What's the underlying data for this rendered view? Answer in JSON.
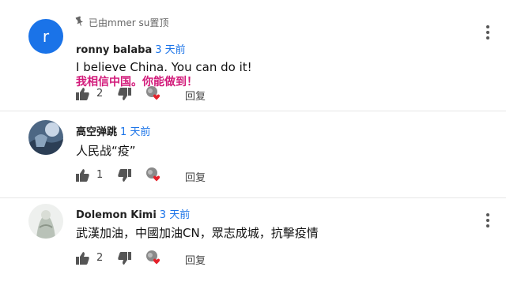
{
  "comments": [
    {
      "pinned_text": "已由mmer su置顶",
      "avatar_letter": "r",
      "author": "ronny balaba",
      "time": "3 天前",
      "text_lines": [
        "I believe  China. You can do it!",
        "我相信中国。你能做到！"
      ],
      "likes": "2",
      "reply_label": "回复"
    },
    {
      "author": "高空弹跳",
      "time": "1 天前",
      "text_lines": [
        "人民战“疫”"
      ],
      "likes": "1",
      "reply_label": "回复"
    },
    {
      "author": "Dolemon Kimi",
      "time": "3 天前",
      "text_lines": [
        "武漢加油，中國加油CN，眾志成城，抗擊疫情"
      ],
      "likes": "2",
      "reply_label": "回复"
    }
  ],
  "colors": {
    "time_blue": "#1a73e8",
    "chinese_highlight": "#d21a7a",
    "avatar_blue": "#1a73e8",
    "heart_red": "#e5212a"
  },
  "icons": [
    "pin-icon",
    "thumb-up-icon",
    "thumb-down-icon",
    "creator-heart-icon",
    "more-vert-icon"
  ]
}
